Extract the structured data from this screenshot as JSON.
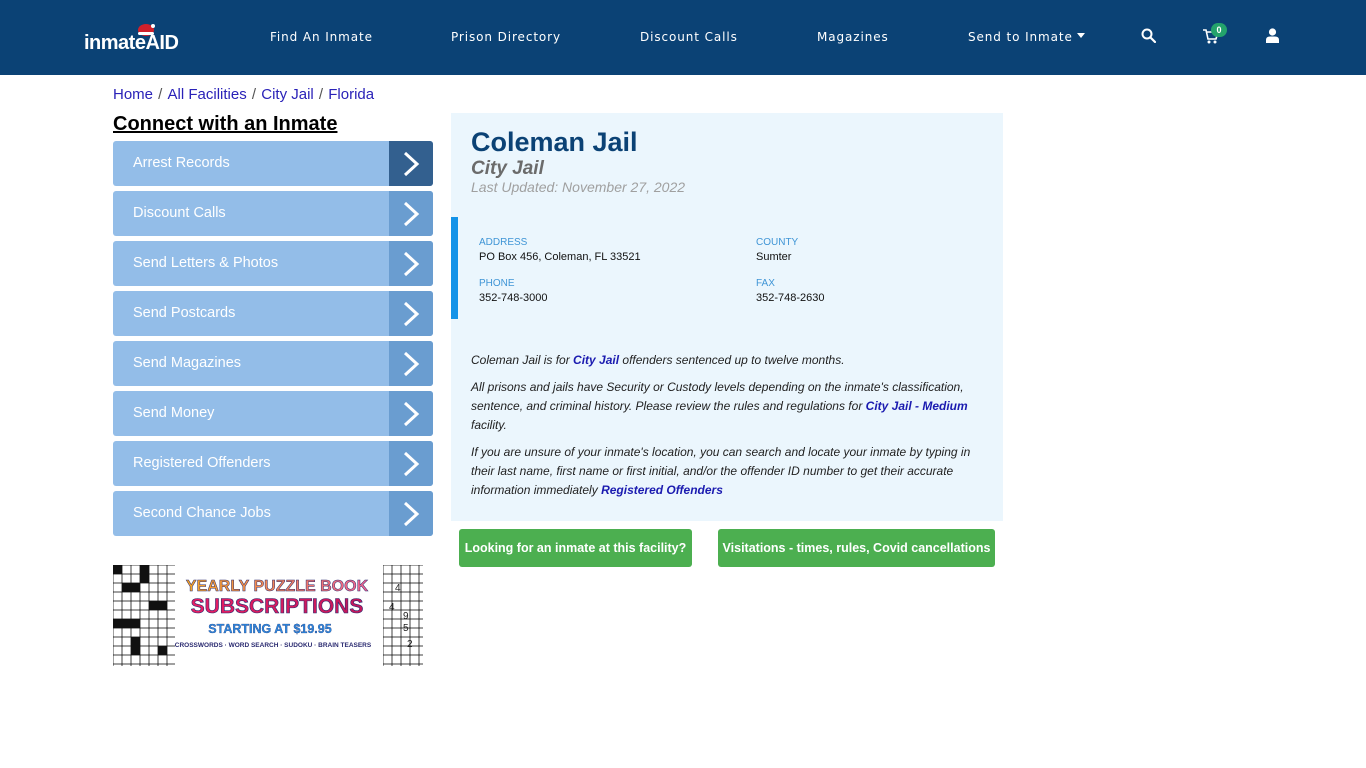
{
  "header": {
    "logo": {
      "text_main": "inmate",
      "text_accent": "AID"
    },
    "nav": [
      {
        "label": "Find An Inmate"
      },
      {
        "label": "Prison Directory"
      },
      {
        "label": "Discount Calls"
      },
      {
        "label": "Magazines"
      },
      {
        "label": "Send to Inmate",
        "has_dropdown": true
      }
    ],
    "icons": {
      "search": "search-icon",
      "cart": "cart-icon",
      "user": "user-icon"
    },
    "cart_count": "0",
    "colors": {
      "bg": "#0b4275",
      "badge": "#24a36b"
    }
  },
  "breadcrumb": [
    {
      "label": "Home"
    },
    {
      "label": "All Facilities"
    },
    {
      "label": "City Jail"
    },
    {
      "label": "Florida"
    }
  ],
  "sidebar": {
    "title": "Connect with an Inmate",
    "items": [
      {
        "label": "Arrest Records",
        "active": true
      },
      {
        "label": "Discount Calls"
      },
      {
        "label": "Send Letters & Photos"
      },
      {
        "label": "Send Postcards"
      },
      {
        "label": "Send Magazines"
      },
      {
        "label": "Send Money"
      },
      {
        "label": "Registered Offenders"
      },
      {
        "label": "Second Chance Jobs"
      }
    ],
    "ad": {
      "line1": "YEARLY PUZZLE BOOK",
      "line2": "SUBSCRIPTIONS",
      "line3": "STARTING AT $19.95",
      "line4": "CROSSWORDS · WORD SEARCH · SUDOKU · BRAIN TEASERS"
    }
  },
  "facility": {
    "name": "Coleman Jail",
    "type": "City Jail",
    "last_updated": "Last Updated: November 27, 2022",
    "address_label": "ADDRESS",
    "address": "PO Box 456, Coleman, FL 33521",
    "county_label": "COUNTY",
    "county": "Sumter",
    "phone_label": "PHONE",
    "phone": "352-748-3000",
    "fax_label": "FAX",
    "fax": "352-748-2630"
  },
  "description": {
    "p1_a": "Coleman Jail is for ",
    "p1_link": "City Jail",
    "p1_b": " offenders sentenced up to twelve months.",
    "p2_a": "All prisons and jails have Security or Custody levels depending on the inmate's classification, sentence, and criminal history. Please review the rules and regulations for ",
    "p2_link": "City Jail - Medium",
    "p2_b": " facility.",
    "p3_a": "If you are unsure of your inmate's location, you can search and locate your inmate by typing in their last name, first name or first initial, and/or the offender ID number to get their accurate information immediately ",
    "p3_link": "Registered Offenders"
  },
  "buttons": {
    "looking": "Looking for an inmate at this facility?",
    "visitations": "Visitations - times, rules, Covid cancellations"
  }
}
